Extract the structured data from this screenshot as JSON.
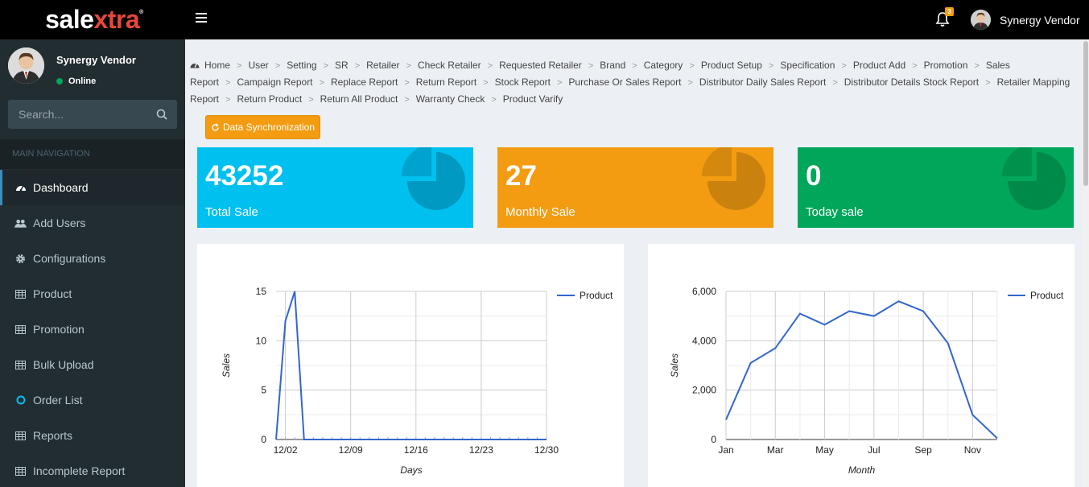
{
  "header": {
    "logo_part1": "sale",
    "logo_part2": "xtra",
    "logo_reg": "®",
    "notification_count": "3",
    "user_name": "Synergy Vendor"
  },
  "sidebar": {
    "user_name": "Synergy Vendor",
    "status": "Online",
    "search_placeholder": "Search...",
    "nav_header": "MAIN NAVIGATION",
    "items": [
      {
        "label": "Dashboard",
        "icon": "dashboard-icon",
        "active": true
      },
      {
        "label": "Add Users",
        "icon": "users-icon"
      },
      {
        "label": "Configurations",
        "icon": "gear-icon"
      },
      {
        "label": "Product",
        "icon": "table-icon"
      },
      {
        "label": "Promotion",
        "icon": "table-icon"
      },
      {
        "label": "Bulk Upload",
        "icon": "table-icon"
      },
      {
        "label": "Order List",
        "icon": "circle-icon"
      },
      {
        "label": "Reports",
        "icon": "table-icon"
      },
      {
        "label": "Incomplete Report",
        "icon": "table-icon"
      }
    ]
  },
  "breadcrumb": [
    "Home",
    "User",
    "Setting",
    "SR",
    "Retailer",
    "Check Retailer",
    "Requested Retailer",
    "Brand",
    "Category",
    "Product Setup",
    "Specification",
    "Product Add",
    "Promotion",
    "Sales Report",
    "Campaign Report",
    "Replace Report",
    "Return Report",
    "Stock Report",
    "Purchase Or Sales Report",
    "Distributor Daily Sales Report",
    "Distributor Details Stock Report",
    "Retailer Mapping Report",
    "Return Product",
    "Return All Product",
    "Warranty Check",
    "Product Varify"
  ],
  "sync_button": "Data Synchronization",
  "stats": [
    {
      "value": "43252",
      "label": "Total Sale",
      "color": "#00c0ef",
      "icon_color": "#0099c1"
    },
    {
      "value": "27",
      "label": "Monthly Sale",
      "color": "#f39c12",
      "icon_color": "#cb810e"
    },
    {
      "value": "0",
      "label": "Today sale",
      "color": "#00a65a",
      "icon_color": "#008a4a"
    }
  ],
  "chart_data": [
    {
      "type": "line",
      "title": "",
      "xlabel": "Days",
      "ylabel": "Sales",
      "x_tick_labels": [
        "12/02",
        "12/09",
        "12/16",
        "12/23",
        "12/30"
      ],
      "ylim": [
        0,
        15
      ],
      "y_ticks": [
        "0",
        "5",
        "10",
        "15"
      ],
      "legend": "top-right",
      "color": "#3366cc",
      "series": [
        {
          "name": "Product",
          "x": [
            1,
            2,
            3,
            4,
            5,
            6,
            7,
            8,
            9,
            10,
            11,
            12,
            13,
            14,
            15,
            16,
            17,
            18,
            19,
            20,
            21,
            22,
            23,
            24,
            25,
            26,
            27,
            28,
            29,
            30
          ],
          "values": [
            0,
            12,
            15,
            0,
            0,
            0,
            0,
            0,
            0,
            0,
            0,
            0,
            0,
            0,
            0,
            0,
            0,
            0,
            0,
            0,
            0,
            0,
            0,
            0,
            0,
            0,
            0,
            0,
            0,
            0
          ]
        }
      ]
    },
    {
      "type": "line",
      "title": "",
      "xlabel": "Month",
      "ylabel": "Sales",
      "x_tick_labels": [
        "Jan",
        "Mar",
        "May",
        "Jul",
        "Sep",
        "Nov"
      ],
      "categories": [
        "Jan",
        "Feb",
        "Mar",
        "Apr",
        "May",
        "Jun",
        "Jul",
        "Aug",
        "Sep",
        "Oct",
        "Nov",
        "Dec"
      ],
      "ylim": [
        0,
        6000
      ],
      "y_ticks": [
        "0",
        "2,000",
        "4,000",
        "6,000"
      ],
      "legend": "top-right",
      "color": "#3366cc",
      "series": [
        {
          "name": "Product",
          "values": [
            800,
            3100,
            3700,
            5100,
            4650,
            5200,
            5000,
            5600,
            5200,
            3900,
            1000,
            50
          ]
        }
      ]
    }
  ]
}
